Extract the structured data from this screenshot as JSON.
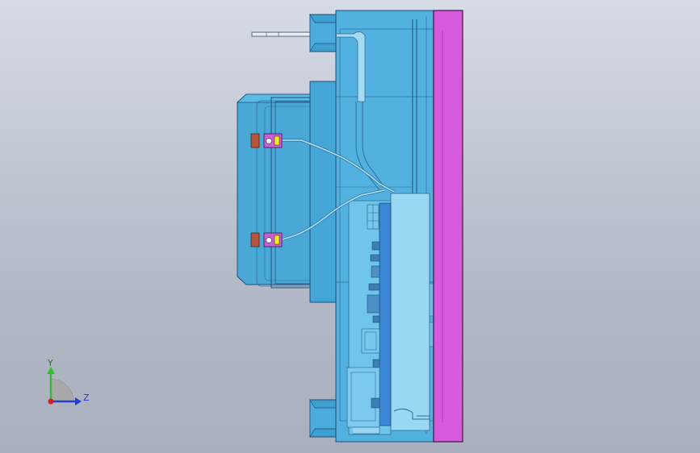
{
  "viewport": {
    "background_top": "#d6dbe6",
    "background_bottom": "#a9afbd"
  },
  "model": {
    "housing_color": "#4fb0dd",
    "housing_edge": "#1d4f78",
    "plate_color": "#d65bdc",
    "plate_edge": "#3a1740",
    "pcb_color": "#8fd3f4",
    "pcb_edge": "#2f6e99",
    "board_blue": "#3a88d4",
    "pin_color": "#e8eef2",
    "red_marker": "#b5563c",
    "yellow_marker": "#f4ea22"
  },
  "triad": {
    "y_label": "Y",
    "z_label": "Z",
    "y_color": "#30c030",
    "z_color": "#1f3fd0",
    "x_color": "#d02020"
  }
}
